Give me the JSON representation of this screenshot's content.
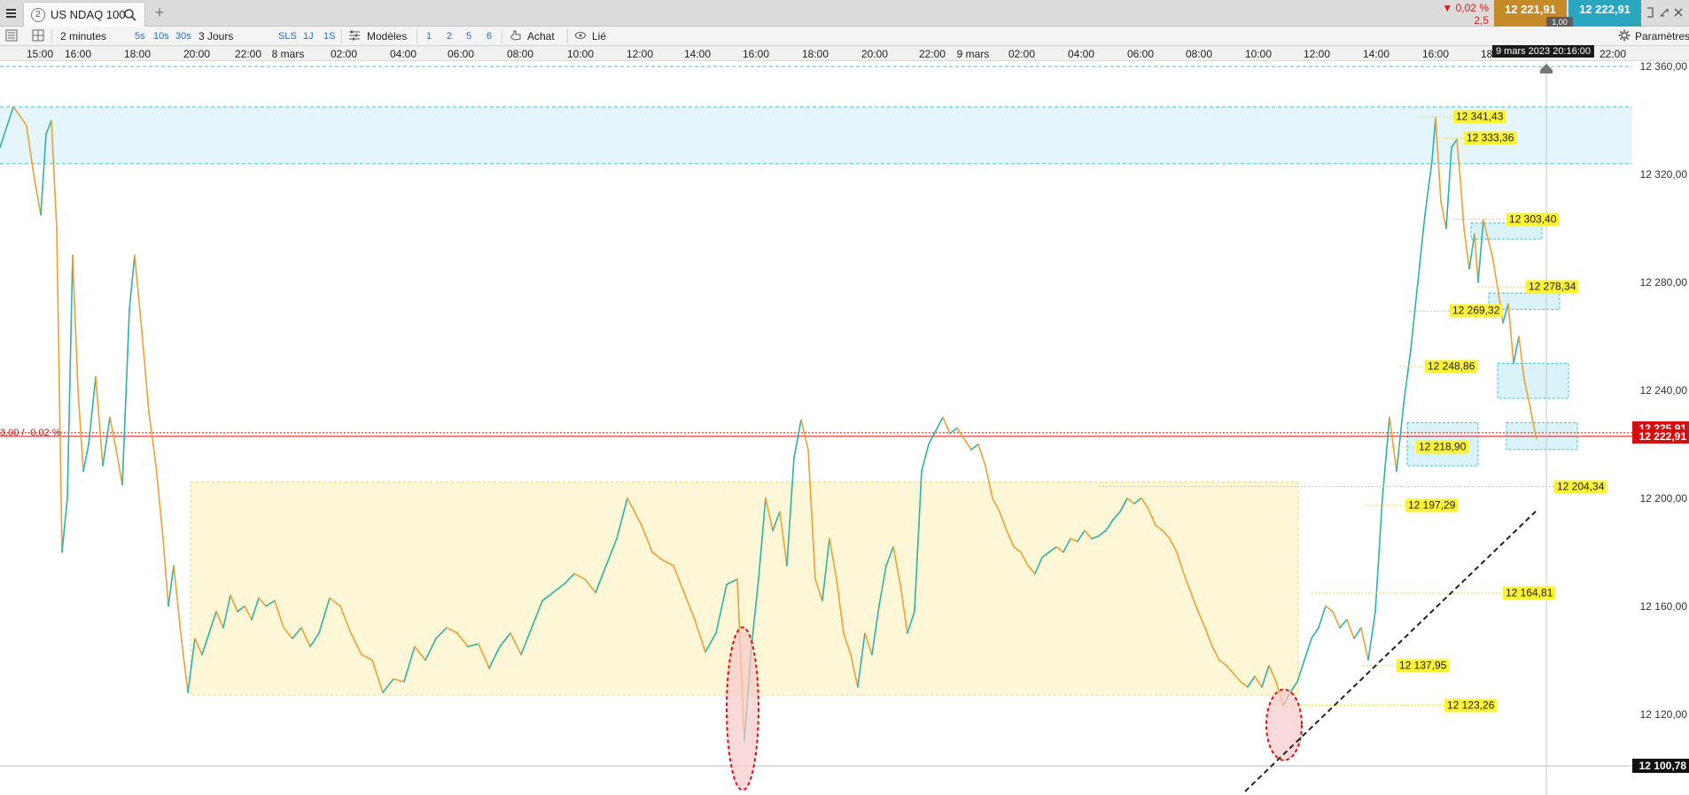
{
  "window": {
    "tab_number": "2",
    "instrument": "US NDAQ 100",
    "price_change_pct": "▼ 0,02 %",
    "price_change_abs": "2,5",
    "sell_price": "12 221,91",
    "buy_price": "12 222,91",
    "spread": "1,00",
    "icons": [
      "menu-icon",
      "search-icon",
      "plus-icon",
      "fullscreen-icon",
      "minimize-icon",
      "close-icon"
    ]
  },
  "toolbar": {
    "timeframe": "2 minutes",
    "quick_timeframes": [
      "5s",
      "10s",
      "30s"
    ],
    "period": "3 Jours",
    "quick_periods": [
      "SLS",
      "1J",
      "1S"
    ],
    "templates_label": "Modèles",
    "layout_counts": [
      "1",
      "2",
      "5",
      "6"
    ],
    "buy_label": "Achat",
    "linked_label": "Lié",
    "settings_label": "Paramètres"
  },
  "cursor_date": "9 mars 2023 20:16:00",
  "chart_data": {
    "type": "line",
    "title": "",
    "instrument": "US NDAQ 100",
    "xlabel": "",
    "ylabel": "",
    "x_axis_ticks": [
      "15:00",
      "16:00",
      "18:00",
      "20:00",
      "22:00",
      "8 mars",
      "02:00",
      "04:00",
      "06:00",
      "08:00",
      "10:00",
      "12:00",
      "14:00",
      "16:00",
      "18:00",
      "20:00",
      "22:00",
      "9 mars",
      "02:00",
      "04:00",
      "06:00",
      "08:00",
      "10:00",
      "12:00",
      "14:00",
      "16:00",
      "18:00",
      "22:00"
    ],
    "y_axis_ticks": [
      "12 360,00",
      "12 320,00",
      "12 280,00",
      "12 240,00",
      "12 200,00",
      "12 160,00",
      "12 120,00"
    ],
    "ylim": [
      12090,
      12362
    ],
    "grid": false,
    "current_price": 12222.91,
    "current_price_label": "12 222,91",
    "hidden_price_label": "12 225,91",
    "reference_label": "3,00 / -0,02 %",
    "low_price_label": "12 100,78",
    "low_price": 12100.78,
    "levels": [
      {
        "value": 12341.43,
        "label": "12 341,43"
      },
      {
        "value": 12333.36,
        "label": "12 333,36"
      },
      {
        "value": 12303.4,
        "label": "12 303,40"
      },
      {
        "value": 12278.34,
        "label": "12 278,34"
      },
      {
        "value": 12269.32,
        "label": "12 269,32"
      },
      {
        "value": 12248.86,
        "label": "12 248,86"
      },
      {
        "value": 12218.9,
        "label": "12 218,90"
      },
      {
        "value": 12204.34,
        "label": "12 204,34"
      },
      {
        "value": 12197.29,
        "label": "12 197,29"
      },
      {
        "value": 12164.81,
        "label": "12 164,81"
      },
      {
        "value": 12137.95,
        "label": "12 137,95"
      },
      {
        "value": 12123.26,
        "label": "12 123,26"
      }
    ],
    "zones": {
      "upper_resistance": [
        12324,
        12345
      ],
      "consolidation_range": [
        12127,
        12206
      ],
      "top_line": 12360
    },
    "series": [
      {
        "points": [
          [
            0,
            12330
          ],
          [
            8,
            12338
          ],
          [
            15,
            12345
          ],
          [
            22,
            12342
          ],
          [
            30,
            12338
          ],
          [
            38,
            12320
          ],
          [
            46,
            12305
          ],
          [
            52,
            12335
          ],
          [
            58,
            12340
          ],
          [
            64,
            12300
          ],
          [
            70,
            12180
          ],
          [
            76,
            12200
          ],
          [
            82,
            12290
          ],
          [
            88,
            12240
          ],
          [
            94,
            12210
          ],
          [
            100,
            12220
          ],
          [
            108,
            12245
          ],
          [
            116,
            12212
          ],
          [
            124,
            12230
          ],
          [
            130,
            12220
          ],
          [
            138,
            12205
          ],
          [
            146,
            12270
          ],
          [
            152,
            12290
          ],
          [
            160,
            12262
          ],
          [
            168,
            12232
          ],
          [
            176,
            12212
          ],
          [
            184,
            12185
          ],
          [
            190,
            12160
          ],
          [
            196,
            12175
          ],
          [
            204,
            12150
          ],
          [
            212,
            12128
          ],
          [
            220,
            12148
          ],
          [
            228,
            12142
          ],
          [
            236,
            12150
          ],
          [
            244,
            12158
          ],
          [
            252,
            12152
          ],
          [
            260,
            12164
          ],
          [
            268,
            12158
          ],
          [
            276,
            12160
          ],
          [
            284,
            12155
          ],
          [
            292,
            12163
          ],
          [
            300,
            12160
          ],
          [
            310,
            12162
          ],
          [
            320,
            12152
          ],
          [
            330,
            12148
          ],
          [
            340,
            12152
          ],
          [
            350,
            12145
          ],
          [
            360,
            12150
          ],
          [
            372,
            12163
          ],
          [
            384,
            12160
          ],
          [
            396,
            12150
          ],
          [
            408,
            12142
          ],
          [
            420,
            12140
          ],
          [
            432,
            12128
          ],
          [
            444,
            12133
          ],
          [
            456,
            12132
          ],
          [
            468,
            12145
          ],
          [
            480,
            12140
          ],
          [
            492,
            12148
          ],
          [
            504,
            12152
          ],
          [
            516,
            12150
          ],
          [
            528,
            12145
          ],
          [
            540,
            12146
          ],
          [
            552,
            12137
          ],
          [
            564,
            12145
          ],
          [
            576,
            12150
          ],
          [
            588,
            12142
          ],
          [
            600,
            12152
          ],
          [
            612,
            12162
          ],
          [
            624,
            12165
          ],
          [
            636,
            12168
          ],
          [
            648,
            12172
          ],
          [
            660,
            12170
          ],
          [
            672,
            12165
          ],
          [
            684,
            12175
          ],
          [
            696,
            12185
          ],
          [
            708,
            12200
          ],
          [
            716,
            12195
          ],
          [
            724,
            12190
          ],
          [
            736,
            12180
          ],
          [
            748,
            12177
          ],
          [
            760,
            12175
          ],
          [
            772,
            12165
          ],
          [
            784,
            12155
          ],
          [
            796,
            12143
          ],
          [
            808,
            12150
          ],
          [
            820,
            12168
          ],
          [
            832,
            12170
          ],
          [
            840,
            12110
          ],
          [
            848,
            12145
          ],
          [
            856,
            12170
          ],
          [
            864,
            12200
          ],
          [
            872,
            12188
          ],
          [
            880,
            12195
          ],
          [
            888,
            12175
          ],
          [
            896,
            12215
          ],
          [
            904,
            12229
          ],
          [
            912,
            12218
          ],
          [
            920,
            12170
          ],
          [
            928,
            12162
          ],
          [
            936,
            12185
          ],
          [
            944,
            12170
          ],
          [
            952,
            12150
          ],
          [
            960,
            12142
          ],
          [
            968,
            12130
          ],
          [
            976,
            12150
          ],
          [
            984,
            12142
          ],
          [
            992,
            12160
          ],
          [
            1000,
            12175
          ],
          [
            1008,
            12182
          ],
          [
            1016,
            12168
          ],
          [
            1024,
            12150
          ],
          [
            1032,
            12158
          ],
          [
            1040,
            12210
          ],
          [
            1048,
            12220
          ],
          [
            1056,
            12225
          ],
          [
            1064,
            12230
          ],
          [
            1072,
            12224
          ],
          [
            1080,
            12226
          ],
          [
            1088,
            12222
          ],
          [
            1096,
            12218
          ],
          [
            1104,
            12220
          ],
          [
            1112,
            12212
          ],
          [
            1120,
            12200
          ],
          [
            1128,
            12195
          ],
          [
            1136,
            12188
          ],
          [
            1144,
            12182
          ],
          [
            1152,
            12180
          ],
          [
            1160,
            12175
          ],
          [
            1168,
            12172
          ],
          [
            1176,
            12178
          ],
          [
            1184,
            12180
          ],
          [
            1192,
            12182
          ],
          [
            1200,
            12180
          ],
          [
            1208,
            12185
          ],
          [
            1216,
            12184
          ],
          [
            1224,
            12188
          ],
          [
            1232,
            12185
          ],
          [
            1240,
            12186
          ],
          [
            1248,
            12188
          ],
          [
            1256,
            12192
          ],
          [
            1264,
            12195
          ],
          [
            1272,
            12200
          ],
          [
            1280,
            12198
          ],
          [
            1288,
            12200
          ],
          [
            1296,
            12196
          ],
          [
            1304,
            12190
          ],
          [
            1312,
            12188
          ],
          [
            1320,
            12185
          ],
          [
            1328,
            12180
          ],
          [
            1336,
            12172
          ],
          [
            1344,
            12165
          ],
          [
            1352,
            12158
          ],
          [
            1360,
            12152
          ],
          [
            1368,
            12145
          ],
          [
            1376,
            12140
          ],
          [
            1384,
            12138
          ],
          [
            1392,
            12135
          ],
          [
            1400,
            12132
          ],
          [
            1408,
            12130
          ],
          [
            1416,
            12134
          ],
          [
            1424,
            12130
          ],
          [
            1432,
            12138
          ],
          [
            1440,
            12132
          ],
          [
            1448,
            12123
          ],
          [
            1456,
            12128
          ],
          [
            1464,
            12132
          ],
          [
            1472,
            12140
          ],
          [
            1480,
            12148
          ],
          [
            1488,
            12152
          ],
          [
            1496,
            12160
          ],
          [
            1504,
            12158
          ],
          [
            1512,
            12152
          ],
          [
            1520,
            12155
          ],
          [
            1528,
            12148
          ],
          [
            1536,
            12152
          ],
          [
            1544,
            12140
          ],
          [
            1552,
            12158
          ],
          [
            1560,
            12200
          ],
          [
            1568,
            12230
          ],
          [
            1576,
            12210
          ],
          [
            1584,
            12235
          ],
          [
            1592,
            12255
          ],
          [
            1600,
            12280
          ],
          [
            1608,
            12305
          ],
          [
            1616,
            12325
          ],
          [
            1620,
            12341
          ],
          [
            1626,
            12310
          ],
          [
            1632,
            12300
          ],
          [
            1638,
            12330
          ],
          [
            1644,
            12333
          ],
          [
            1648,
            12318
          ],
          [
            1652,
            12300
          ],
          [
            1658,
            12285
          ],
          [
            1664,
            12298
          ],
          [
            1668,
            12280
          ],
          [
            1674,
            12303
          ],
          [
            1680,
            12295
          ],
          [
            1684,
            12290
          ],
          [
            1690,
            12278
          ],
          [
            1696,
            12265
          ],
          [
            1702,
            12272
          ],
          [
            1708,
            12250
          ],
          [
            1714,
            12260
          ],
          [
            1720,
            12244
          ],
          [
            1726,
            12235
          ],
          [
            1730,
            12228
          ],
          [
            1734,
            12222
          ]
        ]
      }
    ],
    "annotations": [
      {
        "type": "ellipse",
        "x": 838,
        "value": 12090,
        "note": "spike low"
      },
      {
        "type": "ellipse",
        "x": 1449,
        "value": 12123,
        "note": "range low"
      },
      {
        "type": "trendline",
        "from": [
          1405,
          12090
        ],
        "to": [
          1733,
          12160
        ]
      }
    ],
    "cursor_line_x": 1745
  }
}
